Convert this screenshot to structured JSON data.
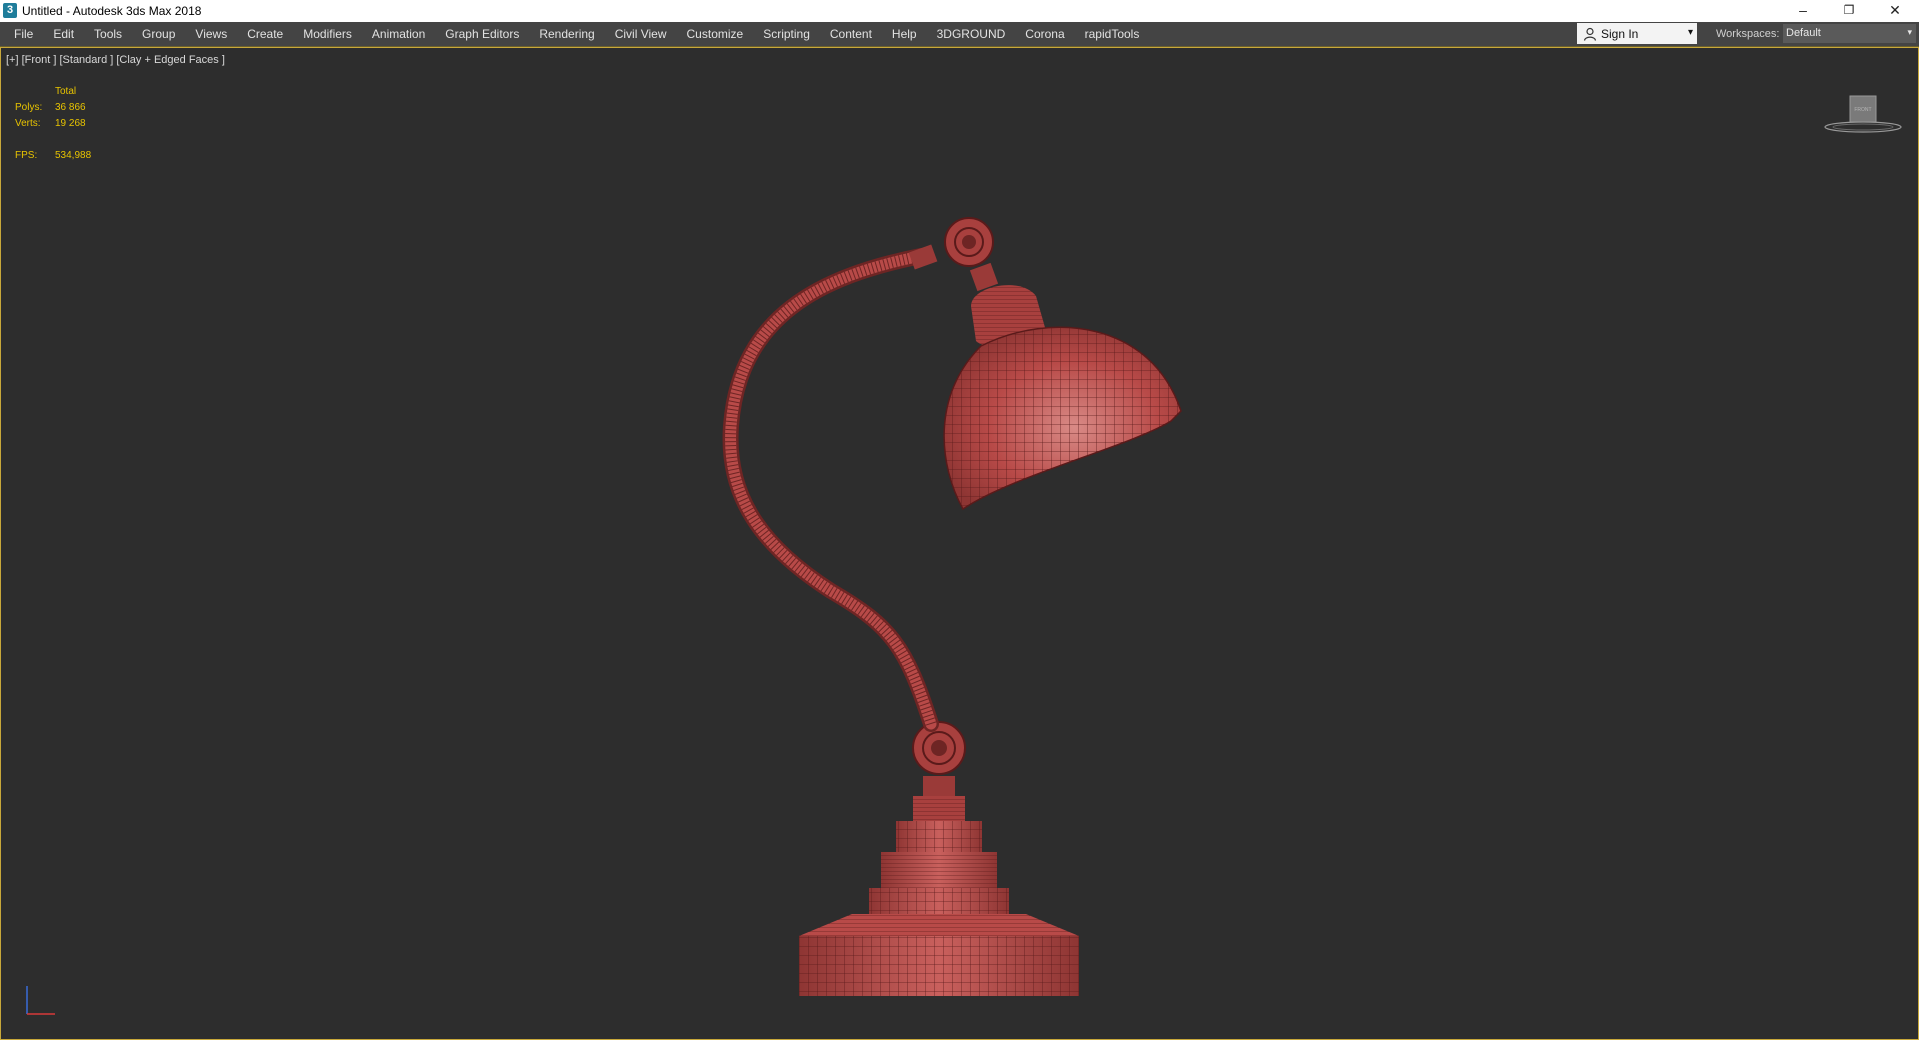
{
  "window": {
    "title": "Untitled - Autodesk 3ds Max 2018",
    "app_icon_glyph": "3",
    "controls": {
      "minimize": "–",
      "restore": "❐",
      "close": "✕"
    }
  },
  "menubar": {
    "items": [
      "File",
      "Edit",
      "Tools",
      "Group",
      "Views",
      "Create",
      "Modifiers",
      "Animation",
      "Graph Editors",
      "Rendering",
      "Civil View",
      "Customize",
      "Scripting",
      "Content",
      "Help",
      "3DGROUND",
      "Corona",
      "rapidTools"
    ],
    "signin": {
      "label": "Sign In",
      "icon": "user-icon",
      "caret": "▾"
    },
    "workspaces": {
      "label": "Workspaces:",
      "value": "Default",
      "caret": "▾"
    }
  },
  "viewport": {
    "label": "[+] [Front ] [Standard ] [Clay + Edged Faces ]",
    "stats": {
      "header": "Total",
      "polys_label": "Polys:",
      "polys": "36 866",
      "verts_label": "Verts:",
      "verts": "19 268",
      "fps_label": "FPS:",
      "fps": "534,988"
    },
    "viewcube_face": "FRONT",
    "model_color": "#b84a48",
    "wire_color": "#5a1a1a",
    "accent_border": "#c8a83a"
  }
}
